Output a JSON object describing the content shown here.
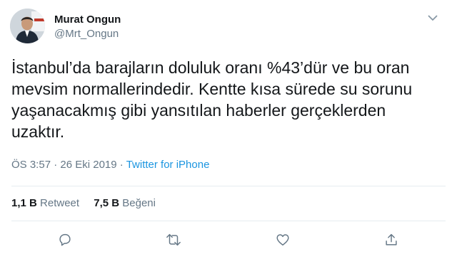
{
  "author": {
    "display_name": "Murat Ongun",
    "handle": "@Mrt_Ongun"
  },
  "tweet": {
    "text": "İstanbul’da barajların doluluk oranı %43’dür ve bu oran mevsim normallerindedir. Kentte kısa sürede su sorunu yaşanacakmış gibi yansıtılan haberler gerçeklerden uzaktır."
  },
  "meta": {
    "time": "ÖS 3:57",
    "date": "26 Eki 2019",
    "separator": "·",
    "source": "Twitter for iPhone"
  },
  "stats": {
    "retweets_count": "1,1 B",
    "retweets_label": "Retweet",
    "likes_count": "7,5 B",
    "likes_label": "Beğeni"
  },
  "icons": {
    "more": "chevron-down-icon",
    "reply": "reply-icon",
    "retweet": "retweet-icon",
    "like": "heart-icon",
    "share": "share-icon"
  },
  "colors": {
    "link": "#1b95e0",
    "secondary_text": "#657786",
    "primary_text": "#14171a",
    "divider": "#e6ecf0"
  }
}
